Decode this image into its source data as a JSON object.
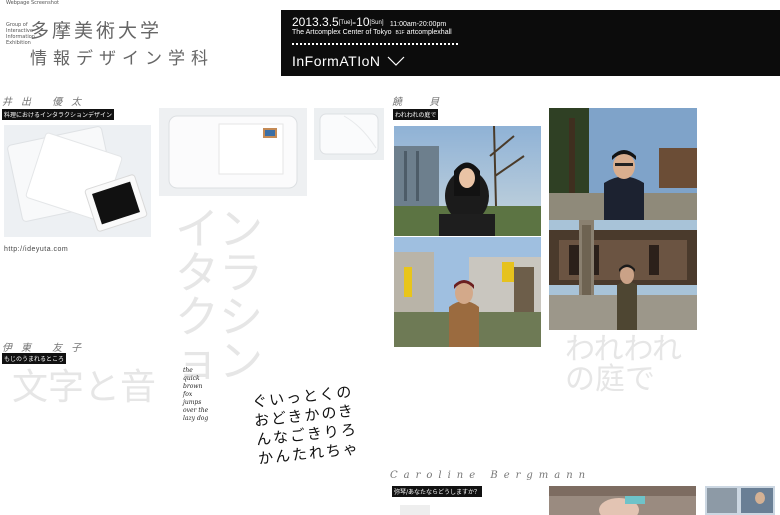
{
  "header": {
    "caption": "Webpage Screenshot",
    "small_lines": [
      "Group of",
      "Interactive",
      "Information",
      "Exhibition"
    ],
    "logo_line1": "多摩美術大学",
    "logo_line2": "情報デザイン学科"
  },
  "info": {
    "dates_main": "2013.3.5",
    "dates_open": "[Tue]",
    "dates_dash": "-10",
    "dates_close": "[Sun]",
    "hours": "11:00am-20:00pm",
    "venue": "The Artcomplex Center of Tokyo",
    "floor": "B1F",
    "hall": "artcomplexhall",
    "button_label": "InFormATIoN"
  },
  "artists": [
    {
      "name": "井出 優太",
      "work": "料理におけるインタラクションデザイン",
      "link": "http://ideyuta.com"
    },
    {
      "name": "饒 貝",
      "work": "われわれの庭で"
    },
    {
      "name": "伊東 友子",
      "work": "もじのうまれるところ"
    },
    {
      "name": "Caroline Bergmann",
      "work": "弥琴/あなたならどうしますか？"
    }
  ],
  "ghost_text": {
    "ide": "インタラクション",
    "rao": "われわれの庭で",
    "ito": "文字と音"
  },
  "sketch_text": "the quick brown fox jumps over the lazy dog",
  "calligraphy_text": "ぐいっとくのおどきかのきんなごきりろかんたれちゃ"
}
